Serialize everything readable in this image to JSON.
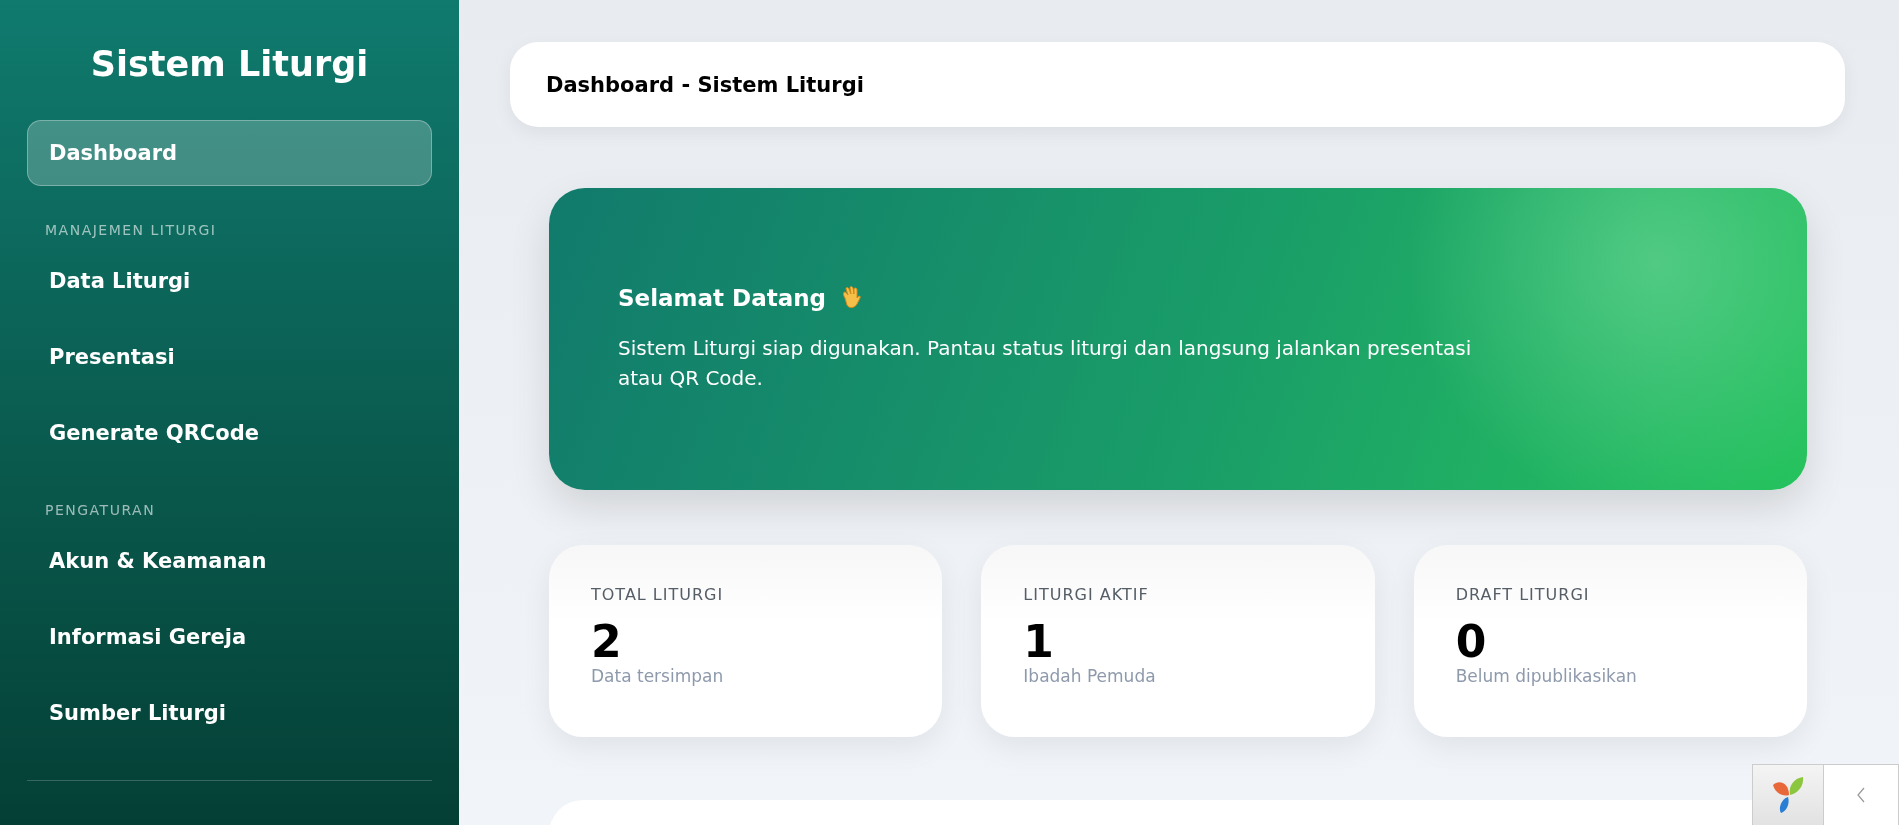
{
  "sidebar": {
    "title": "Sistem Liturgi",
    "sections": [
      {
        "items": [
          {
            "label": "Dashboard",
            "selected": true
          }
        ]
      },
      {
        "heading": "MANAJEMEN LITURGI",
        "items": [
          {
            "label": "Data Liturgi",
            "selected": false
          },
          {
            "label": "Presentasi",
            "selected": false
          },
          {
            "label": "Generate QRCode",
            "selected": false
          }
        ]
      },
      {
        "heading": "PENGATURAN",
        "items": [
          {
            "label": "Akun & Keamanan",
            "selected": false
          },
          {
            "label": "Informasi Gereja",
            "selected": false
          },
          {
            "label": "Sumber Liturgi",
            "selected": false
          }
        ]
      }
    ]
  },
  "header": {
    "title": "Dashboard - Sistem Liturgi"
  },
  "welcome": {
    "title": "Selamat Datang",
    "text": "Sistem Liturgi siap digunakan. Pantau status liturgi dan langsung jalankan presentasi atau QR Code."
  },
  "stats": [
    {
      "label": "TOTAL LITURGI",
      "value": "2",
      "note": "Data tersimpan"
    },
    {
      "label": "LITURGI AKTIF",
      "value": "1",
      "note": "Ibadah Pemuda"
    },
    {
      "label": "DRAFT LITURGI",
      "value": "0",
      "note": "Belum dipublikasikan"
    }
  ]
}
